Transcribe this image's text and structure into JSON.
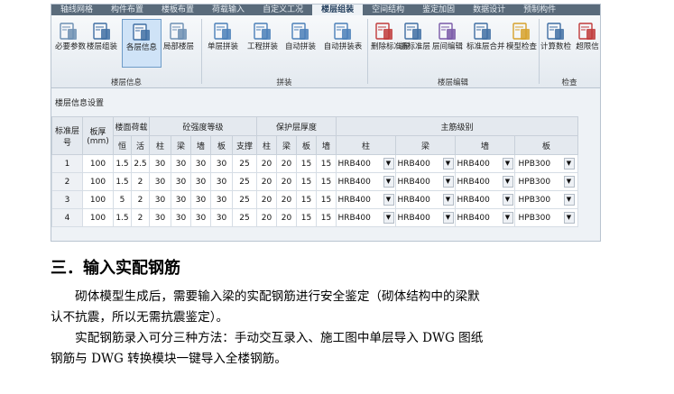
{
  "tabs": [
    "轴线网格",
    "构件布置",
    "楼板布置",
    "荷载输入",
    "自定义工况",
    "楼层组装",
    "空间结构",
    "鉴定加固",
    "数据设计",
    "预制构件"
  ],
  "active_tab": 5,
  "ribbon": {
    "buttons": [
      {
        "label": "必要参数",
        "icon": "parameters-icon",
        "active": false
      },
      {
        "label": "楼层组装",
        "icon": "building-icon",
        "active": false
      },
      {
        "label": "各层信息",
        "icon": "floor-info-icon",
        "active": true
      },
      {
        "label": "局部楼层",
        "icon": "local-floor-icon",
        "active": false
      },
      {
        "label": "单层拼装",
        "icon": "single-assemble-icon",
        "active": false
      },
      {
        "label": "工程拼装",
        "icon": "project-assemble-icon",
        "active": false
      },
      {
        "label": "自动拼装",
        "icon": "auto-assemble-icon",
        "active": false
      },
      {
        "label": "自动拼装表",
        "icon": "auto-assemble-table-icon",
        "active": false
      },
      {
        "label": "删除标准层",
        "icon": "delete-floor-icon",
        "active": false
      },
      {
        "label": "插标准层",
        "icon": "insert-floor-icon",
        "active": false
      },
      {
        "label": "层间编辑",
        "icon": "floor-edit-icon",
        "active": false
      },
      {
        "label": "标准层合并",
        "icon": "merge-floor-icon",
        "active": false
      },
      {
        "label": "模型检查",
        "icon": "model-check-icon",
        "active": false
      },
      {
        "label": "计算数检",
        "icon": "calc-check-icon",
        "active": false
      },
      {
        "label": "超限信",
        "icon": "overlimit-icon",
        "active": false
      }
    ],
    "groups": [
      "楼层信息",
      "拼装",
      "楼层编辑",
      "检查"
    ]
  },
  "panel_title": "楼层信息设置",
  "table": {
    "header": {
      "floor_no": "标准层号",
      "thickness": "板厚(mm)",
      "load": "楼面荷载",
      "load_sub": [
        "恒",
        "活"
      ],
      "concrete": "砼强度等级",
      "concrete_sub": [
        "柱",
        "梁",
        "墙",
        "板",
        "支撑"
      ],
      "cover": "保护层厚度",
      "cover_sub": [
        "柱",
        "梁",
        "板",
        "墙"
      ],
      "rebar": "主筋级别",
      "rebar_sub": [
        "柱",
        "梁",
        "墙",
        "板"
      ]
    },
    "rows": [
      {
        "no": "1",
        "thick": "100",
        "dead": "1.5",
        "live": "2.5",
        "c": [
          "30",
          "30",
          "30",
          "30",
          "25"
        ],
        "cv": [
          "20",
          "20",
          "15",
          "15"
        ],
        "rb": [
          "HRB400",
          "HRB400",
          "HRB400",
          "HPB300"
        ]
      },
      {
        "no": "2",
        "thick": "100",
        "dead": "1.5",
        "live": "2",
        "c": [
          "30",
          "30",
          "30",
          "30",
          "25"
        ],
        "cv": [
          "20",
          "20",
          "15",
          "15"
        ],
        "rb": [
          "HRB400",
          "HRB400",
          "HRB400",
          "HPB300"
        ]
      },
      {
        "no": "3",
        "thick": "100",
        "dead": "5",
        "live": "2",
        "c": [
          "30",
          "30",
          "30",
          "30",
          "25"
        ],
        "cv": [
          "20",
          "20",
          "15",
          "15"
        ],
        "rb": [
          "HRB400",
          "HRB400",
          "HRB400",
          "HPB300"
        ]
      },
      {
        "no": "4",
        "thick": "100",
        "dead": "1.5",
        "live": "2",
        "c": [
          "30",
          "30",
          "30",
          "30",
          "25"
        ],
        "cv": [
          "20",
          "20",
          "15",
          "15"
        ],
        "rb": [
          "HRB400",
          "HRB400",
          "HRB400",
          "HPB300"
        ]
      }
    ]
  },
  "section_heading": "三．输入实配钢筋",
  "paragraphs": [
    "　　砌体模型生成后，需要输入梁的实配钢筋进行安全鉴定（砌体结构中的梁默",
    "认不抗震，所以无需抗震鉴定）。",
    "　　实配钢筋录入可分三种方法：手动交互录入、施工图中单层导入 DWG 图纸",
    "钢筋与 DWG 转换模块一键导入全楼钢筋。"
  ]
}
